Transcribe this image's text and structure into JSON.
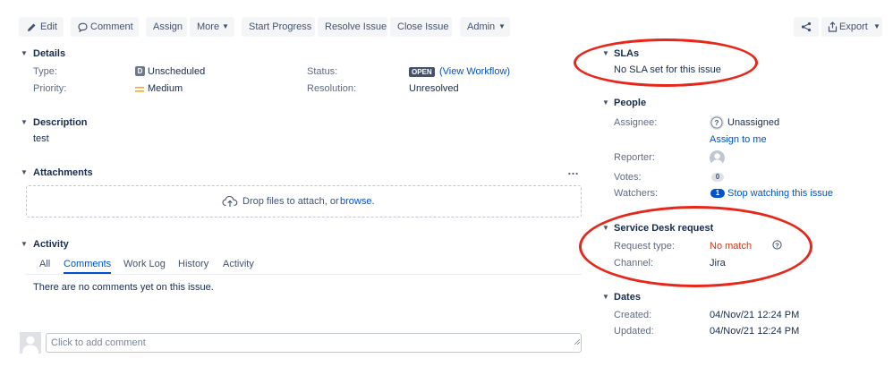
{
  "toolbar": {
    "edit": "Edit",
    "comment": "Comment",
    "assign": "Assign",
    "more": "More",
    "start_progress": "Start Progress",
    "resolve_issue": "Resolve Issue",
    "close_issue": "Close Issue",
    "admin": "Admin",
    "export": "Export"
  },
  "details": {
    "title": "Details",
    "type_label": "Type:",
    "type_value": "Unscheduled",
    "type_icon_letter": "D",
    "priority_label": "Priority:",
    "priority_value": "Medium",
    "status_label": "Status:",
    "status_value": "OPEN",
    "workflow_link": "(View Workflow)",
    "resolution_label": "Resolution:",
    "resolution_value": "Unresolved"
  },
  "description": {
    "title": "Description",
    "text": "test"
  },
  "attachments": {
    "title": "Attachments",
    "more": "…",
    "drop_text": "Drop files to attach, or",
    "browse_link": "browse."
  },
  "activity": {
    "title": "Activity",
    "tabs": [
      "All",
      "Comments",
      "Work Log",
      "History",
      "Activity"
    ],
    "active_tab": "Comments",
    "empty_text": "There are no comments yet on this issue.",
    "comment_placeholder": "Click to add comment"
  },
  "slas": {
    "title": "SLAs",
    "text": "No SLA set for this issue"
  },
  "people": {
    "title": "People",
    "assignee_label": "Assignee:",
    "assignee_value": "Unassigned",
    "assign_to_me": "Assign to me",
    "reporter_label": "Reporter:",
    "votes_label": "Votes:",
    "votes_value": "0",
    "watchers_label": "Watchers:",
    "watchers_count": "1",
    "watchers_link": "Stop watching this issue"
  },
  "service_desk": {
    "title": "Service Desk request",
    "request_type_label": "Request type:",
    "request_type_value": "No match",
    "channel_label": "Channel:",
    "channel_value": "Jira"
  },
  "dates": {
    "title": "Dates",
    "created_label": "Created:",
    "created_value": "04/Nov/21 12:24 PM",
    "updated_label": "Updated:",
    "updated_value": "04/Nov/21 12:24 PM"
  },
  "colors": {
    "link": "#0052cc",
    "annotation_oval": "#e8271b",
    "no_match": "#de350b",
    "priority_medium": "#ffab00"
  }
}
